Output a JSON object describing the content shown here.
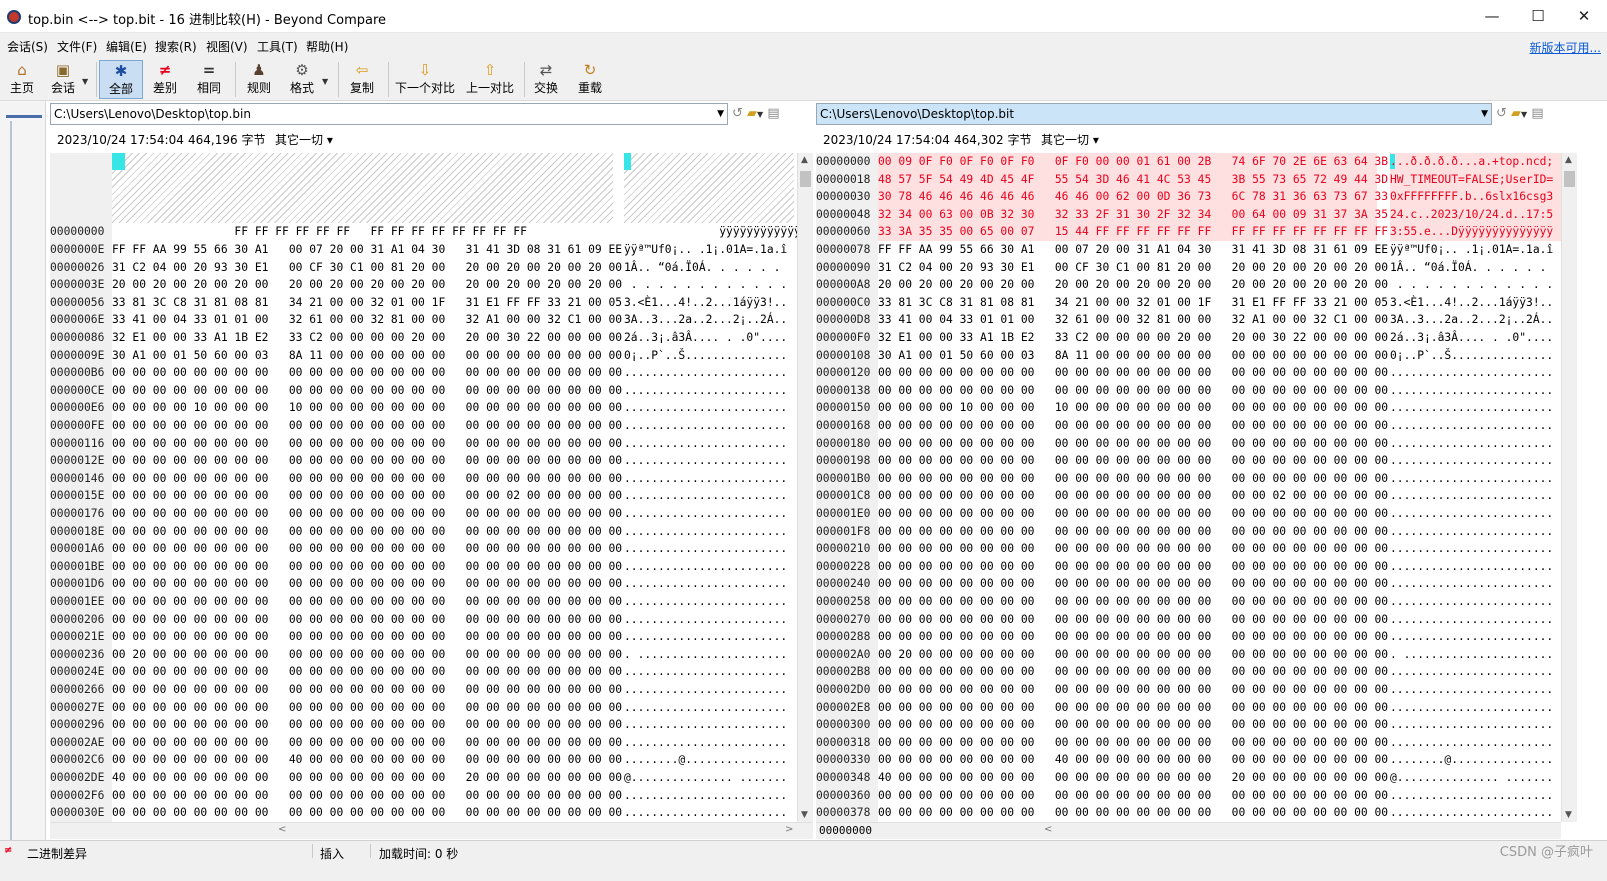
{
  "window": {
    "title": "top.bin <--> top.bit - 16 进制比较(H) - Beyond Compare",
    "min": "—",
    "max": "☐",
    "close": "✕"
  },
  "menu": [
    "会话(S)",
    "文件(F)",
    "编辑(E)",
    "搜索(R)",
    "视图(V)",
    "工具(T)",
    "帮助(H)"
  ],
  "new_version": "新版本可用...",
  "toolbar": [
    {
      "label": "主页",
      "icon": "home-icon",
      "glyph": "⌂"
    },
    {
      "label": "会话",
      "icon": "briefcase-icon",
      "glyph": "▣"
    },
    {
      "label": "全部",
      "icon": "asterisk-icon",
      "glyph": "✱"
    },
    {
      "label": "差别",
      "icon": "not-equal-icon",
      "glyph": "≠"
    },
    {
      "label": "相同",
      "icon": "equal-icon",
      "glyph": "="
    },
    {
      "label": "规则",
      "icon": "referee-icon",
      "glyph": "♟"
    },
    {
      "label": "格式",
      "icon": "gear-icon",
      "glyph": "⚙"
    },
    {
      "label": "复制",
      "icon": "copy-left-icon",
      "glyph": "⇦"
    },
    {
      "label": "下一个对比",
      "icon": "arrow-down-icon",
      "glyph": "⇩"
    },
    {
      "label": "上一对比",
      "icon": "arrow-up-icon",
      "glyph": "⇧"
    },
    {
      "label": "交换",
      "icon": "swap-icon",
      "glyph": "⇄"
    },
    {
      "label": "重载",
      "icon": "reload-icon",
      "glyph": "↻"
    }
  ],
  "left": {
    "path": "C:\\Users\\Lenovo\\Desktop\\top.bin",
    "date": "2023/10/24 17:54:04",
    "size": "464,196 字节",
    "other": "其它一切 ▾",
    "rows": [
      {
        "addr": "00000000",
        "hex": "                  FF FF FF FF FF FF   FF FF FF FF FF FF FF FF",
        "ascii": "              ÿÿÿÿÿÿÿÿÿÿÿÿÿÿ"
      },
      {
        "addr": "0000000E",
        "hex": "FF FF AA 99 55 66 30 A1   00 07 20 00 31 A1 04 30   31 41 3D 08 31 61 09 EE",
        "ascii": "ÿÿª™Uf0¡.. .1¡.01A=.1a.î"
      },
      {
        "addr": "00000026",
        "hex": "31 C2 04 00 20 93 30 E1   00 CF 30 C1 00 81 20 00   20 00 20 00 20 00 20 00",
        "ascii": "1Â.. “0á.Ï0Á. . . . . ."
      },
      {
        "addr": "0000003E",
        "hex": "20 00 20 00 20 00 20 00   20 00 20 00 20 00 20 00   20 00 20 00 20 00 20 00",
        "ascii": " . . . . . . . . . . . ."
      },
      {
        "addr": "00000056",
        "hex": "33 81 3C C8 31 81 08 81   34 21 00 00 32 01 00 1F   31 E1 FF FF 33 21 00 05",
        "ascii": "3.<È1...4!..2...1áÿÿ3!.."
      },
      {
        "addr": "0000006E",
        "hex": "33 41 00 04 33 01 01 00   32 61 00 00 32 81 00 00   32 A1 00 00 32 C1 00 00",
        "ascii": "3A..3...2a..2...2¡..2Á.."
      },
      {
        "addr": "00000086",
        "hex": "32 E1 00 00 33 A1 1B E2   33 C2 00 00 00 00 20 00   20 00 30 22 00 00 00 00",
        "ascii": "2á..3¡.â3Â.... . .0\"...."
      },
      {
        "addr": "0000009E",
        "hex": "30 A1 00 01 50 60 00 03   8A 11 00 00 00 00 00 00   00 00 00 00 00 00 00 00",
        "ascii": "0¡..P`..Š..............."
      },
      {
        "addr": "000000B6",
        "hex": "00 00 00 00 00 00 00 00   00 00 00 00 00 00 00 00   00 00 00 00 00 00 00 00",
        "ascii": "........................"
      },
      {
        "addr": "000000CE",
        "hex": "00 00 00 00 00 00 00 00   00 00 00 00 00 00 00 00   00 00 00 00 00 00 00 00",
        "ascii": "........................"
      },
      {
        "addr": "000000E6",
        "hex": "00 00 00 00 10 00 00 00   10 00 00 00 00 00 00 00   00 00 00 00 00 00 00 00",
        "ascii": "........................"
      },
      {
        "addr": "000000FE",
        "hex": "00 00 00 00 00 00 00 00   00 00 00 00 00 00 00 00   00 00 00 00 00 00 00 00",
        "ascii": "........................"
      },
      {
        "addr": "00000116",
        "hex": "00 00 00 00 00 00 00 00   00 00 00 00 00 00 00 00   00 00 00 00 00 00 00 00",
        "ascii": "........................"
      },
      {
        "addr": "0000012E",
        "hex": "00 00 00 00 00 00 00 00   00 00 00 00 00 00 00 00   00 00 00 00 00 00 00 00",
        "ascii": "........................"
      },
      {
        "addr": "00000146",
        "hex": "00 00 00 00 00 00 00 00   00 00 00 00 00 00 00 00   00 00 00 00 00 00 00 00",
        "ascii": "........................"
      },
      {
        "addr": "0000015E",
        "hex": "00 00 00 00 00 00 00 00   00 00 00 00 00 00 00 00   00 00 02 00 00 00 00 00",
        "ascii": "........................"
      },
      {
        "addr": "00000176",
        "hex": "00 00 00 00 00 00 00 00   00 00 00 00 00 00 00 00   00 00 00 00 00 00 00 00",
        "ascii": "........................"
      },
      {
        "addr": "0000018E",
        "hex": "00 00 00 00 00 00 00 00   00 00 00 00 00 00 00 00   00 00 00 00 00 00 00 00",
        "ascii": "........................"
      },
      {
        "addr": "000001A6",
        "hex": "00 00 00 00 00 00 00 00   00 00 00 00 00 00 00 00   00 00 00 00 00 00 00 00",
        "ascii": "........................"
      },
      {
        "addr": "000001BE",
        "hex": "00 00 00 00 00 00 00 00   00 00 00 00 00 00 00 00   00 00 00 00 00 00 00 00",
        "ascii": "........................"
      },
      {
        "addr": "000001D6",
        "hex": "00 00 00 00 00 00 00 00   00 00 00 00 00 00 00 00   00 00 00 00 00 00 00 00",
        "ascii": "........................"
      },
      {
        "addr": "000001EE",
        "hex": "00 00 00 00 00 00 00 00   00 00 00 00 00 00 00 00   00 00 00 00 00 00 00 00",
        "ascii": "........................"
      },
      {
        "addr": "00000206",
        "hex": "00 00 00 00 00 00 00 00   00 00 00 00 00 00 00 00   00 00 00 00 00 00 00 00",
        "ascii": "........................"
      },
      {
        "addr": "0000021E",
        "hex": "00 00 00 00 00 00 00 00   00 00 00 00 00 00 00 00   00 00 00 00 00 00 00 00",
        "ascii": "........................"
      },
      {
        "addr": "00000236",
        "hex": "00 20 00 00 00 00 00 00   00 00 00 00 00 00 00 00   00 00 00 00 00 00 00 00",
        "ascii": ". ......................"
      },
      {
        "addr": "0000024E",
        "hex": "00 00 00 00 00 00 00 00   00 00 00 00 00 00 00 00   00 00 00 00 00 00 00 00",
        "ascii": "........................"
      },
      {
        "addr": "00000266",
        "hex": "00 00 00 00 00 00 00 00   00 00 00 00 00 00 00 00   00 00 00 00 00 00 00 00",
        "ascii": "........................"
      },
      {
        "addr": "0000027E",
        "hex": "00 00 00 00 00 00 00 00   00 00 00 00 00 00 00 00   00 00 00 00 00 00 00 00",
        "ascii": "........................"
      },
      {
        "addr": "00000296",
        "hex": "00 00 00 00 00 00 00 00   00 00 00 00 00 00 00 00   00 00 00 00 00 00 00 00",
        "ascii": "........................"
      },
      {
        "addr": "000002AE",
        "hex": "00 00 00 00 00 00 00 00   00 00 00 00 00 00 00 00   00 00 00 00 00 00 00 00",
        "ascii": "........................"
      },
      {
        "addr": "000002C6",
        "hex": "00 00 00 00 00 00 00 00   40 00 00 00 00 00 00 00   00 00 00 00 00 00 00 00",
        "ascii": "........@..............."
      },
      {
        "addr": "000002DE",
        "hex": "40 00 00 00 00 00 00 00   00 00 00 00 00 00 00 00   20 00 00 00 00 00 00 00",
        "ascii": "@............... ......."
      },
      {
        "addr": "000002F6",
        "hex": "00 00 00 00 00 00 00 00   00 00 00 00 00 00 00 00   00 00 00 00 00 00 00 00",
        "ascii": "........................"
      },
      {
        "addr": "0000030E",
        "hex": "00 00 00 00 00 00 00 00   00 00 00 00 00 00 00 00   00 00 00 00 00 00 00 00",
        "ascii": "........................"
      }
    ]
  },
  "right": {
    "path": "C:\\Users\\Lenovo\\Desktop\\top.bit",
    "date": "2023/10/24 17:54:04",
    "size": "464,302 字节",
    "other": "其它一切 ▾",
    "footer_addr": "00000000",
    "rows": [
      {
        "addr": "00000000",
        "hex": "00 09 0F F0 0F F0 0F F0   0F F0 00 00 01 61 00 2B   74 6F 70 2E 6E 63 64 3B",
        "ascii": "...ð.ð.ð.ð...a.+top.ncd;"
      },
      {
        "addr": "00000018",
        "hex": "48 57 5F 54 49 4D 45 4F   55 54 3D 46 41 4C 53 45   3B 55 73 65 72 49 44 3D",
        "ascii": "HW_TIMEOUT=FALSE;UserID="
      },
      {
        "addr": "00000030",
        "hex": "30 78 46 46 46 46 46 46   46 46 00 62 00 0D 36 73   6C 78 31 36 63 73 67 33",
        "ascii": "0xFFFFFFFF.b..6slx16csg3"
      },
      {
        "addr": "00000048",
        "hex": "32 34 00 63 00 0B 32 30   32 33 2F 31 30 2F 32 34   00 64 00 09 31 37 3A 35",
        "ascii": "24.c..2023/10/24.d..17:5"
      },
      {
        "addr": "00000060",
        "hex": "33 3A 35 35 00 65 00 07   15 44 FF FF FF FF FF FF   FF FF FF FF FF FF FF FF",
        "ascii": "3:55.e...Dÿÿÿÿÿÿÿÿÿÿÿÿÿÿ"
      },
      {
        "addr": "00000078",
        "hex": "FF FF AA 99 55 66 30 A1   00 07 20 00 31 A1 04 30   31 41 3D 08 31 61 09 EE",
        "ascii": "ÿÿª™Uf0¡.. .1¡.01A=.1a.î"
      },
      {
        "addr": "00000090",
        "hex": "31 C2 04 00 20 93 30 E1   00 CF 30 C1 00 81 20 00   20 00 20 00 20 00 20 00",
        "ascii": "1Â.. “0á.Ï0Á. . . . . ."
      },
      {
        "addr": "000000A8",
        "hex": "20 00 20 00 20 00 20 00   20 00 20 00 20 00 20 00   20 00 20 00 20 00 20 00",
        "ascii": " . . . . . . . . . . . ."
      },
      {
        "addr": "000000C0",
        "hex": "33 81 3C C8 31 81 08 81   34 21 00 00 32 01 00 1F   31 E1 FF FF 33 21 00 05",
        "ascii": "3.<È1...4!..2...1áÿÿ3!.."
      },
      {
        "addr": "000000D8",
        "hex": "33 41 00 04 33 01 01 00   32 61 00 00 32 81 00 00   32 A1 00 00 32 C1 00 00",
        "ascii": "3A..3...2a..2...2¡..2Á.."
      },
      {
        "addr": "000000F0",
        "hex": "32 E1 00 00 33 A1 1B E2   33 C2 00 00 00 00 20 00   20 00 30 22 00 00 00 00",
        "ascii": "2á..3¡.â3Â.... . .0\"...."
      },
      {
        "addr": "00000108",
        "hex": "30 A1 00 01 50 60 00 03   8A 11 00 00 00 00 00 00   00 00 00 00 00 00 00 00",
        "ascii": "0¡..P`..Š..............."
      },
      {
        "addr": "00000120",
        "hex": "00 00 00 00 00 00 00 00   00 00 00 00 00 00 00 00   00 00 00 00 00 00 00 00",
        "ascii": "........................"
      },
      {
        "addr": "00000138",
        "hex": "00 00 00 00 00 00 00 00   00 00 00 00 00 00 00 00   00 00 00 00 00 00 00 00",
        "ascii": "........................"
      },
      {
        "addr": "00000150",
        "hex": "00 00 00 00 10 00 00 00   10 00 00 00 00 00 00 00   00 00 00 00 00 00 00 00",
        "ascii": "........................"
      },
      {
        "addr": "00000168",
        "hex": "00 00 00 00 00 00 00 00   00 00 00 00 00 00 00 00   00 00 00 00 00 00 00 00",
        "ascii": "........................"
      },
      {
        "addr": "00000180",
        "hex": "00 00 00 00 00 00 00 00   00 00 00 00 00 00 00 00   00 00 00 00 00 00 00 00",
        "ascii": "........................"
      },
      {
        "addr": "00000198",
        "hex": "00 00 00 00 00 00 00 00   00 00 00 00 00 00 00 00   00 00 00 00 00 00 00 00",
        "ascii": "........................"
      },
      {
        "addr": "000001B0",
        "hex": "00 00 00 00 00 00 00 00   00 00 00 00 00 00 00 00   00 00 00 00 00 00 00 00",
        "ascii": "........................"
      },
      {
        "addr": "000001C8",
        "hex": "00 00 00 00 00 00 00 00   00 00 00 00 00 00 00 00   00 00 02 00 00 00 00 00",
        "ascii": "........................"
      },
      {
        "addr": "000001E0",
        "hex": "00 00 00 00 00 00 00 00   00 00 00 00 00 00 00 00   00 00 00 00 00 00 00 00",
        "ascii": "........................"
      },
      {
        "addr": "000001F8",
        "hex": "00 00 00 00 00 00 00 00   00 00 00 00 00 00 00 00   00 00 00 00 00 00 00 00",
        "ascii": "........................"
      },
      {
        "addr": "00000210",
        "hex": "00 00 00 00 00 00 00 00   00 00 00 00 00 00 00 00   00 00 00 00 00 00 00 00",
        "ascii": "........................"
      },
      {
        "addr": "00000228",
        "hex": "00 00 00 00 00 00 00 00   00 00 00 00 00 00 00 00   00 00 00 00 00 00 00 00",
        "ascii": "........................"
      },
      {
        "addr": "00000240",
        "hex": "00 00 00 00 00 00 00 00   00 00 00 00 00 00 00 00   00 00 00 00 00 00 00 00",
        "ascii": "........................"
      },
      {
        "addr": "00000258",
        "hex": "00 00 00 00 00 00 00 00   00 00 00 00 00 00 00 00   00 00 00 00 00 00 00 00",
        "ascii": "........................"
      },
      {
        "addr": "00000270",
        "hex": "00 00 00 00 00 00 00 00   00 00 00 00 00 00 00 00   00 00 00 00 00 00 00 00",
        "ascii": "........................"
      },
      {
        "addr": "00000288",
        "hex": "00 00 00 00 00 00 00 00   00 00 00 00 00 00 00 00   00 00 00 00 00 00 00 00",
        "ascii": "........................"
      },
      {
        "addr": "000002A0",
        "hex": "00 20 00 00 00 00 00 00   00 00 00 00 00 00 00 00   00 00 00 00 00 00 00 00",
        "ascii": ". ......................"
      },
      {
        "addr": "000002B8",
        "hex": "00 00 00 00 00 00 00 00   00 00 00 00 00 00 00 00   00 00 00 00 00 00 00 00",
        "ascii": "........................"
      },
      {
        "addr": "000002D0",
        "hex": "00 00 00 00 00 00 00 00   00 00 00 00 00 00 00 00   00 00 00 00 00 00 00 00",
        "ascii": "........................"
      },
      {
        "addr": "000002E8",
        "hex": "00 00 00 00 00 00 00 00   00 00 00 00 00 00 00 00   00 00 00 00 00 00 00 00",
        "ascii": "........................"
      },
      {
        "addr": "00000300",
        "hex": "00 00 00 00 00 00 00 00   00 00 00 00 00 00 00 00   00 00 00 00 00 00 00 00",
        "ascii": "........................"
      },
      {
        "addr": "00000318",
        "hex": "00 00 00 00 00 00 00 00   00 00 00 00 00 00 00 00   00 00 00 00 00 00 00 00",
        "ascii": "........................"
      },
      {
        "addr": "00000330",
        "hex": "00 00 00 00 00 00 00 00   40 00 00 00 00 00 00 00   00 00 00 00 00 00 00 00",
        "ascii": "........@..............."
      },
      {
        "addr": "00000348",
        "hex": "40 00 00 00 00 00 00 00   00 00 00 00 00 00 00 00   20 00 00 00 00 00 00 00",
        "ascii": "@............... ......."
      },
      {
        "addr": "00000360",
        "hex": "00 00 00 00 00 00 00 00   00 00 00 00 00 00 00 00   00 00 00 00 00 00 00 00",
        "ascii": "........................"
      },
      {
        "addr": "00000378",
        "hex": "00 00 00 00 00 00 00 00   00 00 00 00 00 00 00 00   00 00 00 00 00 00 00 00",
        "ascii": "........................"
      }
    ]
  },
  "status": {
    "diff_label": "二进制差异",
    "mode": "插入",
    "load_time": "加载时间:  0 秒",
    "watermark": "CSDN @子疯叶"
  },
  "colors": {
    "diff_red": "#e8001c",
    "diff_bg": "#ffe0e0",
    "cyan_marker": "#36e6e6",
    "active_button": "#c9def3"
  }
}
